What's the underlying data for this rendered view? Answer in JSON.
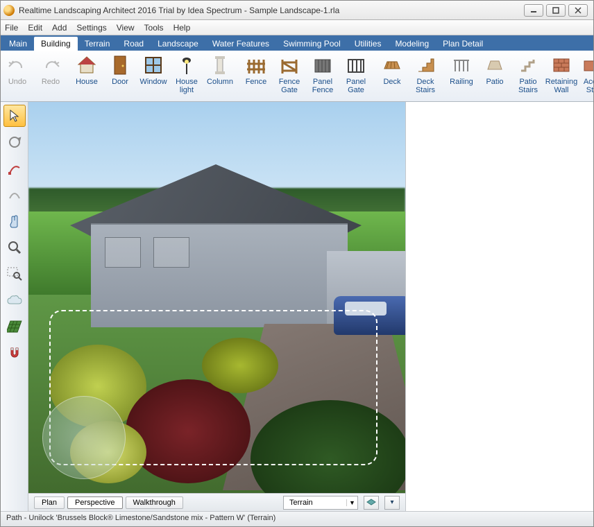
{
  "window": {
    "title": "Realtime Landscaping Architect 2016 Trial by Idea Spectrum - Sample Landscape-1.rla"
  },
  "menu": {
    "items": [
      "File",
      "Edit",
      "Add",
      "Settings",
      "View",
      "Tools",
      "Help"
    ]
  },
  "ribbon_tabs": [
    "Main",
    "Building",
    "Terrain",
    "Road",
    "Landscape",
    "Water Features",
    "Swimming Pool",
    "Utilities",
    "Modeling",
    "Plan Detail"
  ],
  "ribbon_active": "Building",
  "ribbon": {
    "undo": "Undo",
    "redo": "Redo",
    "house": "House",
    "door": "Door",
    "window": "Window",
    "house_light": "House\nlight",
    "column": "Column",
    "fence": "Fence",
    "fence_gate": "Fence\nGate",
    "panel_fence": "Panel\nFence",
    "panel_gate": "Panel\nGate",
    "deck": "Deck",
    "deck_stairs": "Deck\nStairs",
    "railing": "Railing",
    "patio": "Patio",
    "patio_stairs": "Patio\nStairs",
    "retaining_wall": "Retaining\nWall",
    "acc": "Acc\nSt"
  },
  "left_tools": {
    "select": "select-tool",
    "orbit": "orbit-tool",
    "bezier": "curve-tool",
    "arc": "arc-tool",
    "pan": "pan-tool",
    "zoom": "zoom-tool",
    "zoom_region": "zoom-region-tool",
    "cloud": "cloud-tool",
    "grid": "grid-tool",
    "snap": "snap-tool"
  },
  "view_tabs": {
    "plan": "Plan",
    "perspective": "Perspective",
    "walkthrough": "Walkthrough"
  },
  "view_active": "Perspective",
  "layer_dropdown": {
    "selected": "Terrain"
  },
  "status": "Path - Unilock 'Brussels Block® Limestone/Sandstone mix - Pattern W' (Terrain)"
}
